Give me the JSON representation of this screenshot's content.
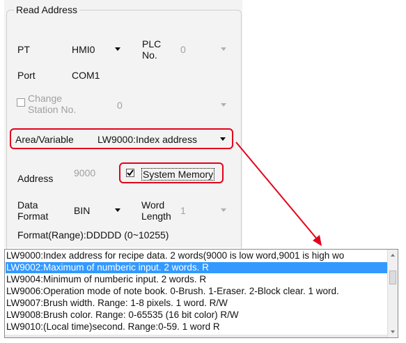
{
  "group": {
    "title": "Read Address"
  },
  "pt": {
    "label": "PT",
    "value": "HMI0"
  },
  "plc_no": {
    "label_line1": "PLC",
    "label_line2": "No.",
    "value": "0"
  },
  "port": {
    "label": "Port",
    "value": "COM1"
  },
  "change_station": {
    "label_line1": "Change",
    "label_line2": "Station No.",
    "checked": false,
    "value": "0"
  },
  "area": {
    "label": "Area/Variable",
    "value": "LW9000:Index address"
  },
  "address": {
    "label": "Address",
    "value": "9000"
  },
  "system_memory": {
    "label": "System Memory",
    "checked": true
  },
  "data_format": {
    "label_line1": "Data",
    "label_line2": "Format",
    "value": "BIN"
  },
  "word_length": {
    "label_line1": "Word",
    "label_line2": "Length",
    "value": "1"
  },
  "format_range": "Format(Range):DDDDD (0~10255)",
  "list": {
    "items": [
      "LW9000:Index address for recipe data. 2 words(9000 is low word,9001 is high wo",
      "LW9002:Maximum of numberic input. 2 words. R",
      "LW9004:Minimum of numberic input. 2 words. R",
      "LW9006:Operation mode of note book. 0-Brush. 1-Eraser. 2-Block clear. 1 word.",
      "LW9007:Brush width. Range: 1-8 pixels. 1 word. R/W",
      "LW9008:Brush color. Range: 0-65535 (16 bit color) R/W",
      "LW9010:(Local time)second. Range:0-59. 1 word R"
    ],
    "selected_index": 1
  },
  "colors": {
    "highlight": "#e3001b",
    "selection": "#3399ff",
    "arrow": "#e3001b"
  }
}
